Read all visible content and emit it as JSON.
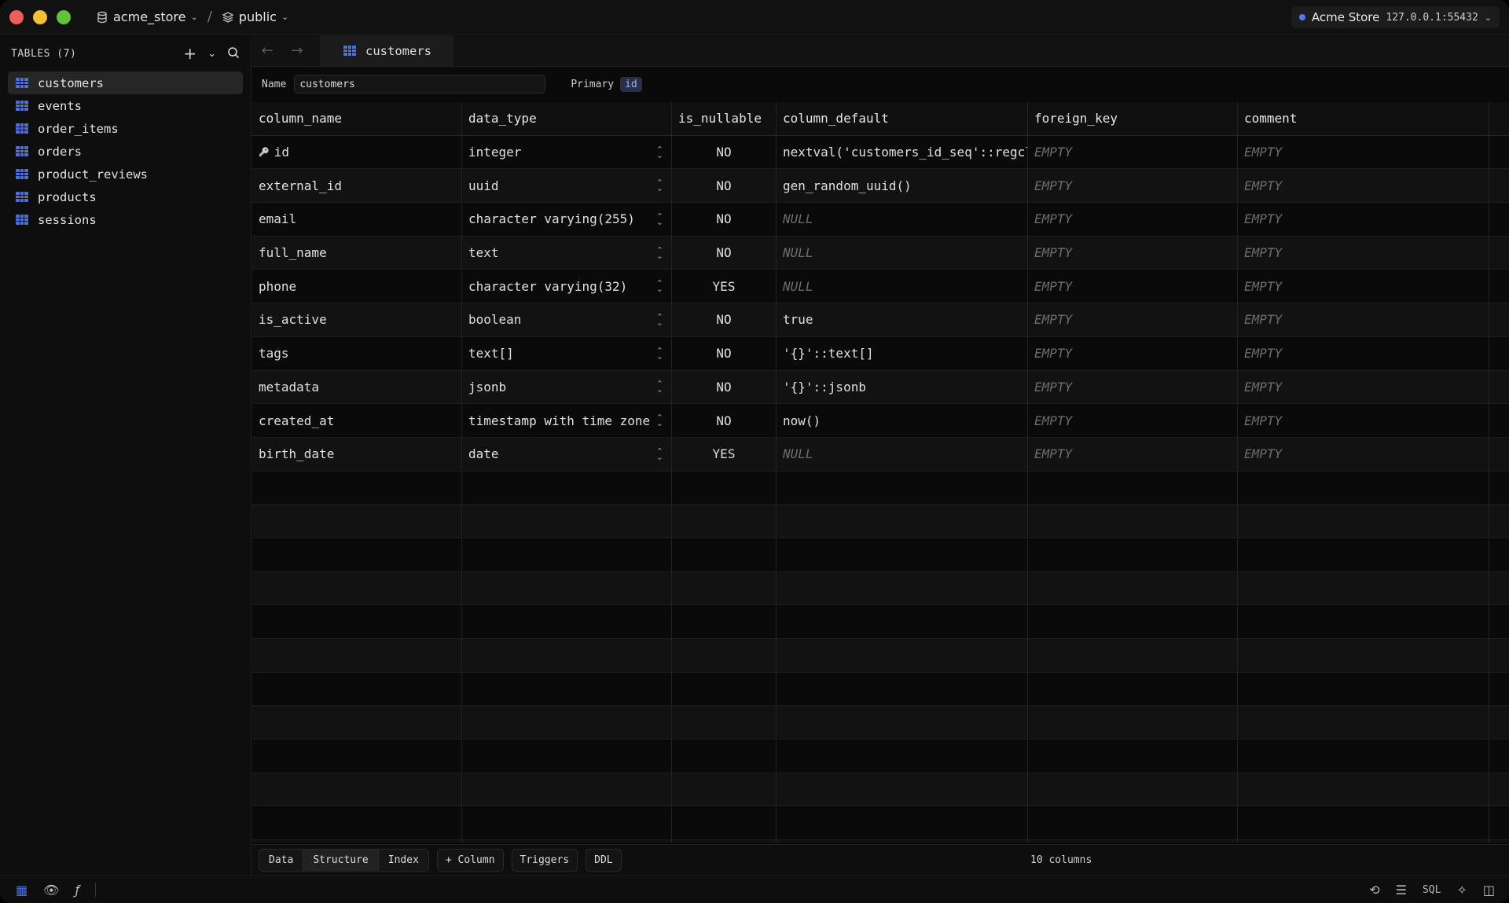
{
  "titlebar": {
    "database": "acme_store",
    "separator": "/",
    "schema": "public",
    "connection_name": "Acme Store",
    "connection_host": "127.0.0.1:55432"
  },
  "sidebar": {
    "heading": "TABLES (7)",
    "items": [
      {
        "label": "customers",
        "active": true
      },
      {
        "label": "events"
      },
      {
        "label": "order_items"
      },
      {
        "label": "orders"
      },
      {
        "label": "product_reviews"
      },
      {
        "label": "products"
      },
      {
        "label": "sessions"
      }
    ]
  },
  "tab": {
    "label": "customers"
  },
  "meta": {
    "name_label": "Name",
    "name_value": "customers",
    "primary_label": "Primary",
    "primary_value": "id"
  },
  "grid": {
    "headers": [
      "column_name",
      "data_type",
      "is_nullable",
      "column_default",
      "foreign_key",
      "comment"
    ],
    "rows": [
      {
        "column_name": "id",
        "data_type": "integer",
        "is_nullable": "NO",
        "column_default": "nextval('customers_id_seq'::regcl…",
        "foreign_key": "EMPTY",
        "comment": "EMPTY",
        "pk": true
      },
      {
        "column_name": "external_id",
        "data_type": "uuid",
        "is_nullable": "NO",
        "column_default": "gen_random_uuid()",
        "foreign_key": "EMPTY",
        "comment": "EMPTY"
      },
      {
        "column_name": "email",
        "data_type": "character varying(255)",
        "is_nullable": "NO",
        "column_default": "NULL",
        "foreign_key": "EMPTY",
        "comment": "EMPTY"
      },
      {
        "column_name": "full_name",
        "data_type": "text",
        "is_nullable": "NO",
        "column_default": "NULL",
        "foreign_key": "EMPTY",
        "comment": "EMPTY"
      },
      {
        "column_name": "phone",
        "data_type": "character varying(32)",
        "is_nullable": "YES",
        "column_default": "NULL",
        "foreign_key": "EMPTY",
        "comment": "EMPTY"
      },
      {
        "column_name": "is_active",
        "data_type": "boolean",
        "is_nullable": "NO",
        "column_default": "true",
        "foreign_key": "EMPTY",
        "comment": "EMPTY"
      },
      {
        "column_name": "tags",
        "data_type": "text[]",
        "is_nullable": "NO",
        "column_default": "'{}'::text[]",
        "foreign_key": "EMPTY",
        "comment": "EMPTY"
      },
      {
        "column_name": "metadata",
        "data_type": "jsonb",
        "is_nullable": "NO",
        "column_default": "'{}'::jsonb",
        "foreign_key": "EMPTY",
        "comment": "EMPTY"
      },
      {
        "column_name": "created_at",
        "data_type": "timestamp with time zone",
        "is_nullable": "NO",
        "column_default": "now()",
        "foreign_key": "EMPTY",
        "comment": "EMPTY"
      },
      {
        "column_name": "birth_date",
        "data_type": "date",
        "is_nullable": "YES",
        "column_default": "NULL",
        "foreign_key": "EMPTY",
        "comment": "EMPTY"
      }
    ]
  },
  "bottombar": {
    "tabs": [
      "Data",
      "Structure",
      "Index"
    ],
    "active_tab": "Structure",
    "add_column": "+ Column",
    "triggers": "Triggers",
    "ddl": "DDL",
    "column_count": "10 columns"
  },
  "statusbar": {
    "sql_label": "SQL"
  },
  "colors": {
    "accent": "#4c72d9",
    "background": "#0a0a0a"
  }
}
